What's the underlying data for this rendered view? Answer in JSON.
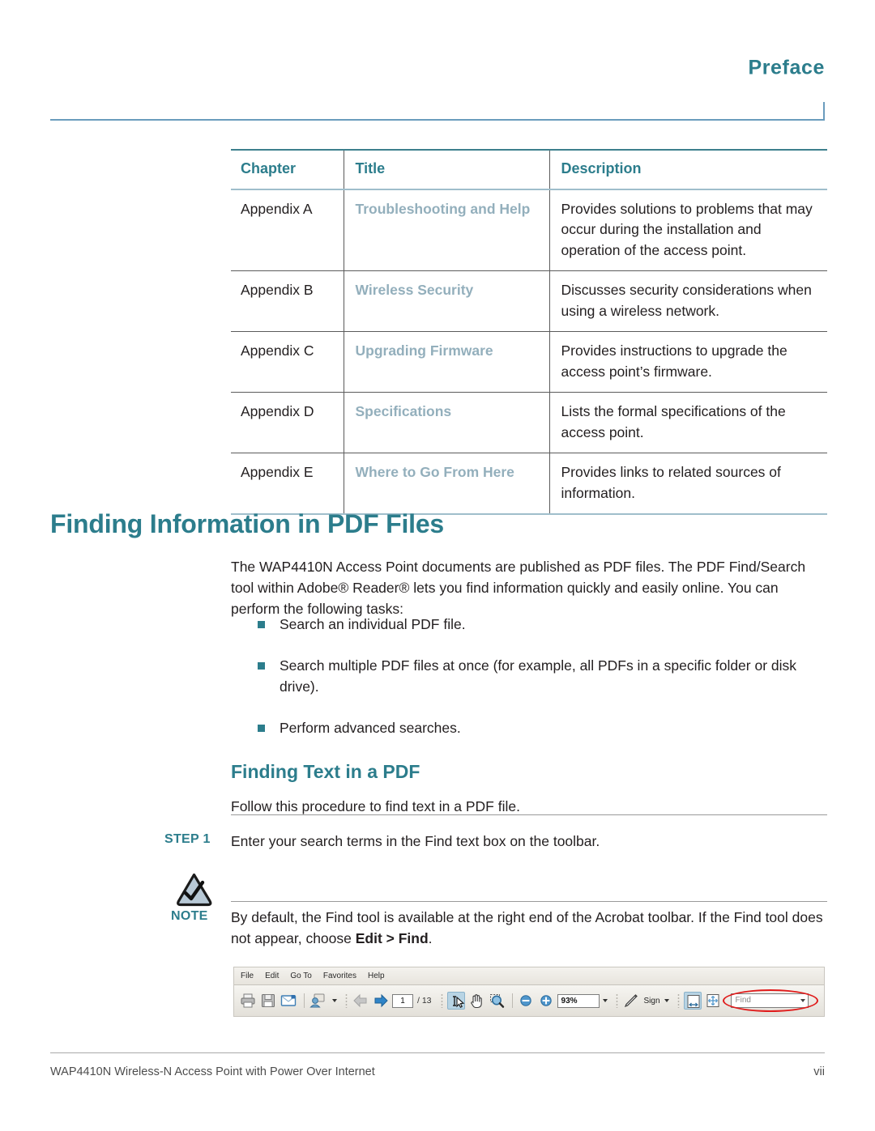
{
  "header": {
    "title": "Preface"
  },
  "chapter_table": {
    "columns": [
      "Chapter",
      "Title",
      "Description"
    ],
    "rows": [
      {
        "chapter": "Appendix A",
        "title": "Troubleshooting and Help",
        "description": "Provides solutions to problems that may occur during the installation and operation of the access point."
      },
      {
        "chapter": "Appendix B",
        "title": "Wireless Security",
        "description": "Discusses security considerations when using a wireless network."
      },
      {
        "chapter": "Appendix C",
        "title": "Upgrading Firmware",
        "description": "Provides instructions to upgrade the access point’s firmware."
      },
      {
        "chapter": "Appendix D",
        "title": "Specifications",
        "description": "Lists the formal specifications of the access point."
      },
      {
        "chapter": "Appendix E",
        "title": "Where to Go From Here",
        "description": "Provides links to related sources of information."
      }
    ]
  },
  "section": {
    "h1": "Finding Information in PDF Files",
    "intro": "The WAP4410N Access Point documents are published as PDF files. The PDF Find/Search tool within Adobe® Reader® lets you find information quickly and easily online. You can perform the following tasks:",
    "bullets": [
      "Search an individual PDF file.",
      "Search multiple PDF files at once (for example, all PDFs in a specific folder or disk drive).",
      "Perform advanced searches."
    ],
    "h2": "Finding Text in a PDF",
    "follow": "Follow this procedure to find text in a PDF file."
  },
  "step": {
    "label": "STEP 1",
    "text": "Enter your search terms in the Find text box on the toolbar."
  },
  "note": {
    "label": "NOTE",
    "text_before": "By default, the Find tool is available at the right end of the Acrobat toolbar. If the Find tool does not appear, choose ",
    "bold_part": "Edit > Find",
    "text_after": "."
  },
  "acrobat_toolbar": {
    "menu_items": [
      "File",
      "Edit",
      "Go To",
      "Favorites",
      "Help"
    ],
    "icons": {
      "print": "print-icon",
      "save": "save-icon",
      "email": "email-icon",
      "share": "share-icon",
      "previous_page": "previous-page-arrow-icon",
      "next_page": "next-page-arrow-icon",
      "select_tool": "select-text-tool-icon",
      "hand_tool": "hand-tool-icon",
      "zoom_tool": "marquee-zoom-tool-icon",
      "zoom_out": "zoom-out-icon",
      "zoom_in": "zoom-in-icon",
      "sign_pen": "sign-pen-icon",
      "fit_width": "fit-width-icon",
      "fit_page": "fit-page-icon"
    },
    "page_number": "1",
    "page_total": "/ 13",
    "zoom_level": "93%",
    "sign_label": "Sign",
    "find_placeholder": "Find"
  },
  "footer": {
    "left": "WAP4410N Wireless-N Access Point with Power Over Internet",
    "right": "vii"
  },
  "colors": {
    "heading_teal": "#2c7d8c",
    "link_blue_gray": "#93afbc",
    "rule_blue": "#6a9cbd",
    "annotation_red": "#e01b1b"
  }
}
